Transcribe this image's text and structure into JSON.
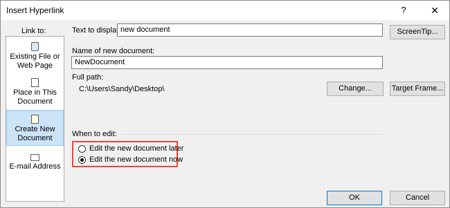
{
  "window": {
    "title": "Insert Hyperlink",
    "help": "?",
    "close": "✕"
  },
  "link_to": {
    "label": "Link to:",
    "items": [
      {
        "label": "Existing File or Web Page",
        "icon": "globe-document-icon"
      },
      {
        "label": "Place in This Document",
        "icon": "document-icon"
      },
      {
        "label": "Create New Document",
        "icon": "new-document-icon",
        "selected": true
      },
      {
        "label": "E-mail Address",
        "icon": "email-icon"
      }
    ]
  },
  "text_to_display": {
    "label": "Text to display:",
    "value": "new document"
  },
  "screentip_button": "ScreenTip...",
  "new_doc_name": {
    "label": "Name of new document:",
    "value": "NewDocument"
  },
  "full_path": {
    "label": "Full path:",
    "value": "C:\\Users\\Sandy\\Desktop\\"
  },
  "change_button": "Change...",
  "target_frame_button": "Target Frame...",
  "when_to_edit": {
    "label": "When to edit:",
    "options": [
      {
        "label": "Edit the new document later",
        "selected": false
      },
      {
        "label": "Edit the new document now",
        "selected": true
      }
    ]
  },
  "ok_button": "OK",
  "cancel_button": "Cancel"
}
